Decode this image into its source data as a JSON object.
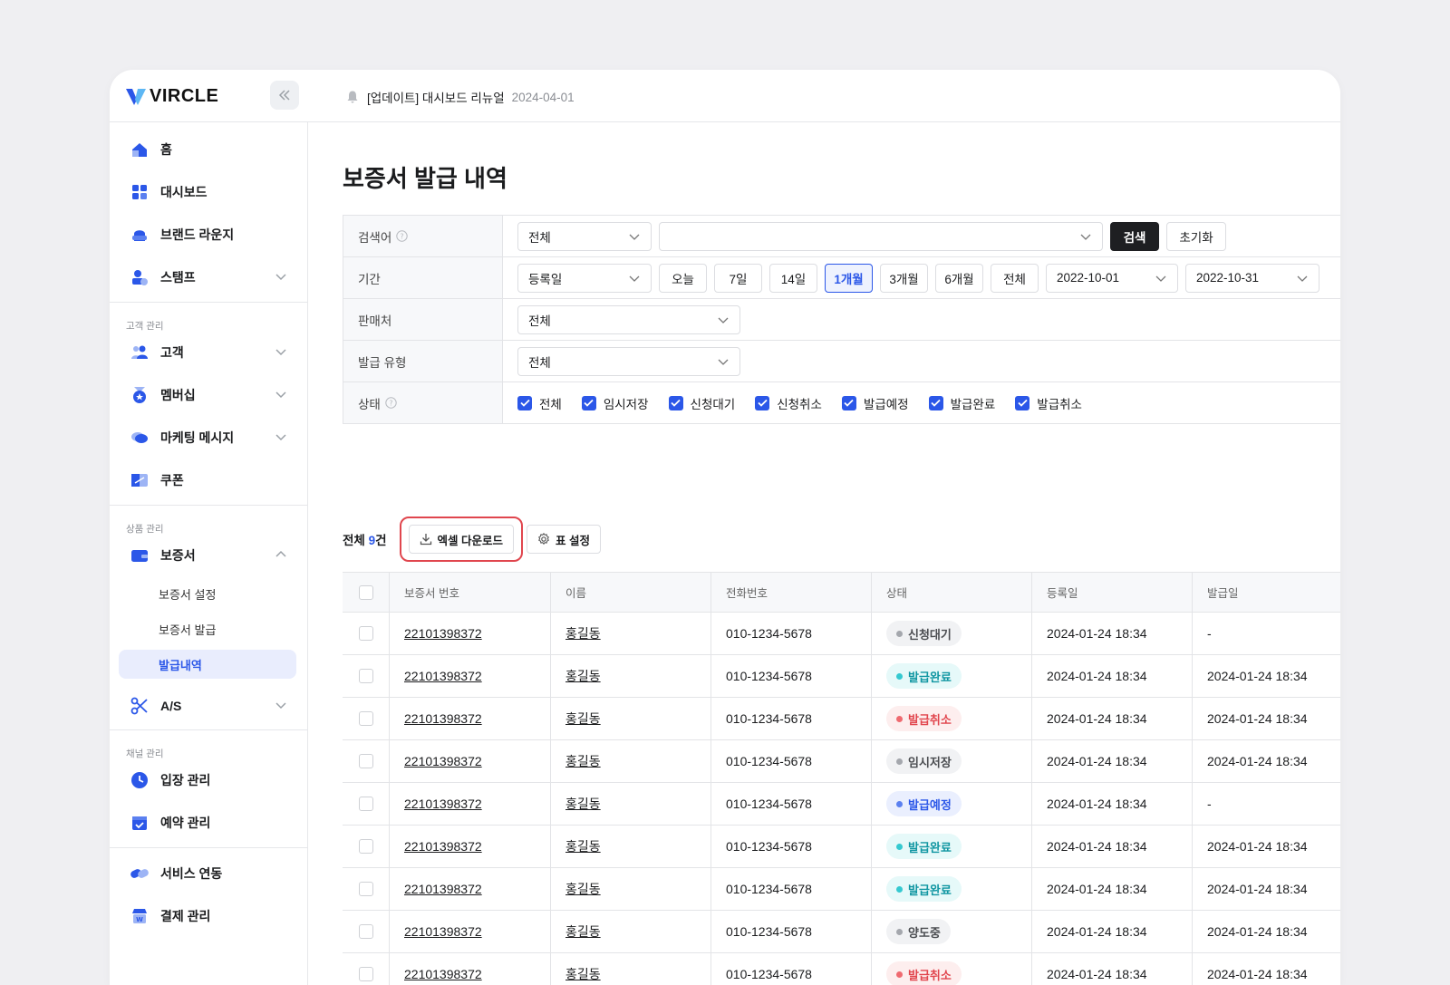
{
  "app": {
    "logo_text": "VIRCLE"
  },
  "notice": {
    "text": "[업데이트] 대시보드 리뉴얼",
    "date": "2024-04-01"
  },
  "sidebar": {
    "items": [
      {
        "label": "홈"
      },
      {
        "label": "대시보드"
      },
      {
        "label": "브랜드 라운지"
      },
      {
        "label": "스탬프"
      },
      {
        "label": "고객"
      },
      {
        "label": "멤버십"
      },
      {
        "label": "마케팅 메시지"
      },
      {
        "label": "쿠폰"
      },
      {
        "label": "보증서"
      },
      {
        "label": "A/S"
      },
      {
        "label": "입장 관리"
      },
      {
        "label": "예약 관리"
      },
      {
        "label": "서비스 연동"
      },
      {
        "label": "결제 관리"
      }
    ],
    "sections": {
      "customer": "고객 관리",
      "product": "상품 관리",
      "channel": "채널 관리"
    },
    "sub_items": [
      {
        "label": "보증서 설정"
      },
      {
        "label": "보증서 발급"
      },
      {
        "label": "발급내역"
      }
    ]
  },
  "page": {
    "title": "보증서 발급 내역"
  },
  "filter": {
    "search": {
      "label": "검색어",
      "scope": "전체",
      "query": "",
      "search_button": "검색",
      "reset_button": "초기화"
    },
    "period": {
      "label": "기간",
      "date_type": "등록일",
      "presets": [
        "오늘",
        "7일",
        "14일",
        "1개월",
        "3개월",
        "6개월",
        "전체"
      ],
      "active_preset": "1개월",
      "start": "2022-10-01",
      "end": "2022-10-31"
    },
    "seller": {
      "label": "판매처",
      "value": "전체"
    },
    "issue_type": {
      "label": "발급 유형",
      "value": "전체"
    },
    "status": {
      "label": "상태",
      "options": [
        "전체",
        "임시저장",
        "신청대기",
        "신청취소",
        "발급예정",
        "발급완료",
        "발급취소"
      ]
    }
  },
  "toolbar": {
    "total_label": "전체",
    "total_count": "9",
    "total_unit": "건",
    "excel_label": "엑셀 다운로드",
    "settings_label": "표 설정"
  },
  "table": {
    "columns": [
      "보증서 번호",
      "이름",
      "전화번호",
      "상태",
      "등록일",
      "발급일"
    ],
    "rows": [
      {
        "no": "22101398372",
        "name": "홍길동",
        "phone": "010-1234-5678",
        "status": "신청대기",
        "tone": "gray",
        "registered": "2024-01-24 18:34",
        "issued": "-"
      },
      {
        "no": "22101398372",
        "name": "홍길동",
        "phone": "010-1234-5678",
        "status": "발급완료",
        "tone": "teal",
        "registered": "2024-01-24 18:34",
        "issued": "2024-01-24 18:34"
      },
      {
        "no": "22101398372",
        "name": "홍길동",
        "phone": "010-1234-5678",
        "status": "발급취소",
        "tone": "red",
        "registered": "2024-01-24 18:34",
        "issued": "2024-01-24 18:34"
      },
      {
        "no": "22101398372",
        "name": "홍길동",
        "phone": "010-1234-5678",
        "status": "임시저장",
        "tone": "gray",
        "registered": "2024-01-24 18:34",
        "issued": "2024-01-24 18:34"
      },
      {
        "no": "22101398372",
        "name": "홍길동",
        "phone": "010-1234-5678",
        "status": "발급예정",
        "tone": "blue",
        "registered": "2024-01-24 18:34",
        "issued": "-"
      },
      {
        "no": "22101398372",
        "name": "홍길동",
        "phone": "010-1234-5678",
        "status": "발급완료",
        "tone": "teal",
        "registered": "2024-01-24 18:34",
        "issued": "2024-01-24 18:34"
      },
      {
        "no": "22101398372",
        "name": "홍길동",
        "phone": "010-1234-5678",
        "status": "발급완료",
        "tone": "teal",
        "registered": "2024-01-24 18:34",
        "issued": "2024-01-24 18:34"
      },
      {
        "no": "22101398372",
        "name": "홍길동",
        "phone": "010-1234-5678",
        "status": "양도중",
        "tone": "gray",
        "registered": "2024-01-24 18:34",
        "issued": "2024-01-24 18:34"
      },
      {
        "no": "22101398372",
        "name": "홍길동",
        "phone": "010-1234-5678",
        "status": "발급취소",
        "tone": "red",
        "registered": "2024-01-24 18:34",
        "issued": "2024-01-24 18:34"
      }
    ]
  },
  "colors": {
    "accent": "#2b57e8",
    "highlight_border": "#e0464e",
    "dark_button": "#1e1f22"
  }
}
